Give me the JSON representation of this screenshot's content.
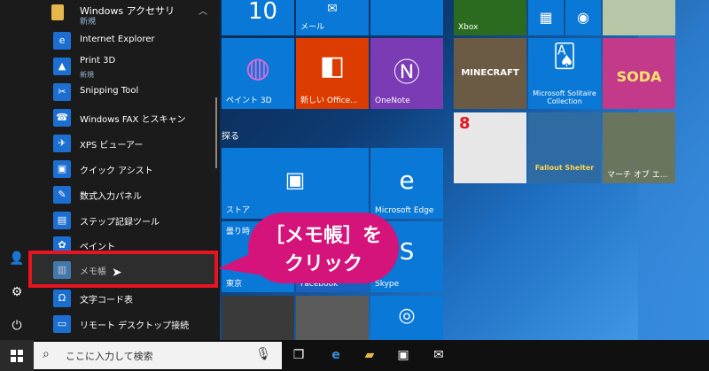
{
  "start_menu": {
    "group": {
      "title": "Windows アクセサリ",
      "new_badge": "新規"
    },
    "apps": [
      {
        "label": "Internet Explorer",
        "sub": ""
      },
      {
        "label": "Print 3D",
        "sub": "新規"
      },
      {
        "label": "Snipping Tool",
        "sub": ""
      },
      {
        "label": "Windows FAX とスキャン",
        "sub": ""
      },
      {
        "label": "XPS ビューアー",
        "sub": ""
      },
      {
        "label": "クイック アシスト",
        "sub": ""
      },
      {
        "label": "数式入力パネル",
        "sub": ""
      },
      {
        "label": "ステップ記録ツール",
        "sub": ""
      },
      {
        "label": "ペイント",
        "sub": ""
      },
      {
        "label": "メモ帳",
        "sub": ""
      },
      {
        "label": "文字コード表",
        "sub": ""
      },
      {
        "label": "リモート デスクトップ接続",
        "sub": ""
      }
    ]
  },
  "tiles": {
    "calendar_day": "10",
    "mail": "メール",
    "xbox": "Xbox",
    "paint3d": "ペイント 3D",
    "office": "新しい Office...",
    "onenote": "OneNote",
    "minecraft_logo": "MINECRAFT",
    "solitaire": "Microsoft Solitaire Collection",
    "candy_logo": "SODA",
    "explore_section": "探る",
    "store": "ストア",
    "edge": "Microsoft Edge",
    "game8": "8",
    "fallout_logo": "Fallout Shelter",
    "march_empires": "マーチ オブ エ...",
    "weather": "曇り時",
    "tokyo": "東京",
    "facebook": "Facebook",
    "skype": "Skype"
  },
  "callout": {
    "line1": "［メモ帳］を",
    "line2": "クリック"
  },
  "taskbar": {
    "search_placeholder": "ここに入力して検索"
  },
  "colors": {
    "tile_blue": "#0a78d7",
    "office_orange": "#dc3c00",
    "onenote_purple": "#7a3bb5",
    "callout_pink": "#d4147a",
    "highlight_red": "#e8141f"
  }
}
